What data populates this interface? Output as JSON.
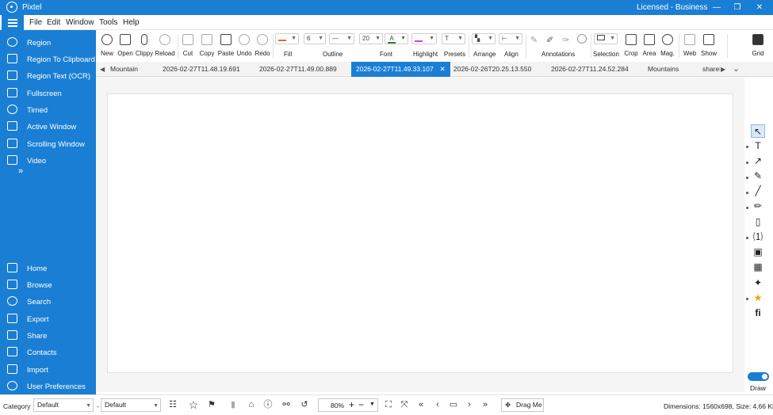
{
  "app": {
    "title": "Pixtel",
    "license": "Licensed - Business",
    "icon": "pixtel-logo-icon"
  },
  "window_controls": {
    "minimize": "—",
    "restore": "❐",
    "close": "✕"
  },
  "menu": {
    "items": [
      "File",
      "Edit",
      "Window",
      "Tools",
      "Help"
    ]
  },
  "sidebar": {
    "top_items": [
      {
        "label": "Region",
        "icon": "region-icon"
      },
      {
        "label": "Region To Clipboard",
        "icon": "clipboard-icon"
      },
      {
        "label": "Region Text (OCR)",
        "icon": "ocr-icon"
      },
      {
        "label": "Fullscreen",
        "icon": "fullscreen-icon"
      },
      {
        "label": "Timed",
        "icon": "timer-icon"
      },
      {
        "label": "Active Window",
        "icon": "window-icon"
      },
      {
        "label": "Scrolling Window",
        "icon": "scroll-window-icon"
      },
      {
        "label": "Video",
        "icon": "video-icon"
      }
    ],
    "more": "»",
    "bottom_items": [
      {
        "label": "Home",
        "icon": "home-icon"
      },
      {
        "label": "Browse",
        "icon": "folder-icon"
      },
      {
        "label": "Search",
        "icon": "search-icon"
      },
      {
        "label": "Export",
        "icon": "export-icon"
      },
      {
        "label": "Share",
        "icon": "share-icon"
      },
      {
        "label": "Contacts",
        "icon": "contacts-icon"
      },
      {
        "label": "Import",
        "icon": "import-icon"
      },
      {
        "label": "User Preferences",
        "icon": "user-icon"
      }
    ]
  },
  "toolbar": {
    "new": "New",
    "open": "Open",
    "clippy": "Clippy",
    "reload": "Reload",
    "cut": "Cut",
    "copy": "Copy",
    "paste": "Paste",
    "undo": "Undo",
    "redo": "Redo",
    "fill": "Fill",
    "outline_width": "6",
    "outline": "Outline",
    "font_size": "20",
    "font": "Font",
    "highlight": "Highlight",
    "presets": "Presets",
    "arrange": "Arrange",
    "align": "Align",
    "annotations": "Annotations",
    "selection": "Selection",
    "crop": "Crop",
    "area": "Area",
    "mag": "Mag.",
    "web": "Web",
    "show": "Show",
    "grid": "Grid"
  },
  "tabs": {
    "items": [
      "Mountain",
      "2026-02-27T11.48.19.691",
      "2026-02-27T11.49.00.889",
      "2026-02-27T11.49.33.107",
      "2026-02-26T20.25.13.550",
      "2026-02-27T11.24.52.284",
      "Mountains",
      "sharel"
    ],
    "active_index": 3,
    "close": "✕",
    "nav_left": "◀",
    "nav_right": "▶",
    "overflow": "⌄"
  },
  "palette": {
    "tools": [
      "select-icon",
      "text-icon",
      "arrow-icon",
      "pen-icon",
      "line-icon",
      "marker-icon",
      "note-icon",
      "step-number-icon",
      "stamp-icon",
      "blur-icon",
      "magic-icon",
      "star-icon",
      "font-ligature-icon"
    ],
    "draw_label": "Draw"
  },
  "statusbar": {
    "category_label": "Category",
    "category_value": "Default",
    "separator": "-",
    "tag_value": "Default",
    "zoom": "80%",
    "drag": "Drag Me",
    "dimensions": "Dimensions: 1560x698, Size: 4.66 KB"
  }
}
